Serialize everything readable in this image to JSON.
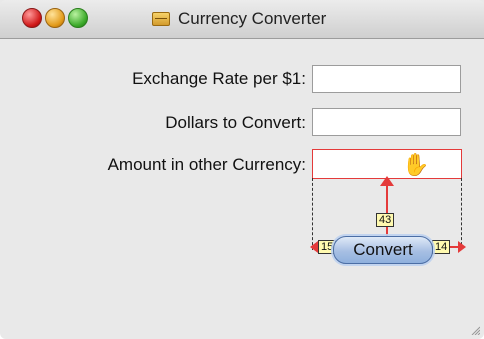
{
  "window": {
    "title": "Currency Converter",
    "icons": {
      "close": "close-icon",
      "minimize": "minimize-icon",
      "maximize": "maximize-icon",
      "document": "document-icon"
    }
  },
  "form": {
    "labels": {
      "exchange_rate": "Exchange Rate per $1:",
      "dollars_to_convert": "Dollars to Convert:",
      "amount_other_currency": "Amount in other Currency:"
    },
    "values": {
      "exchange_rate": "",
      "dollars_to_convert": "",
      "amount_other_currency": ""
    }
  },
  "convert_button": {
    "label": "Convert"
  },
  "layout_guides": {
    "metric_top": "43",
    "metric_left": "15",
    "metric_right": "14",
    "accent_color": "#e43a3a"
  }
}
